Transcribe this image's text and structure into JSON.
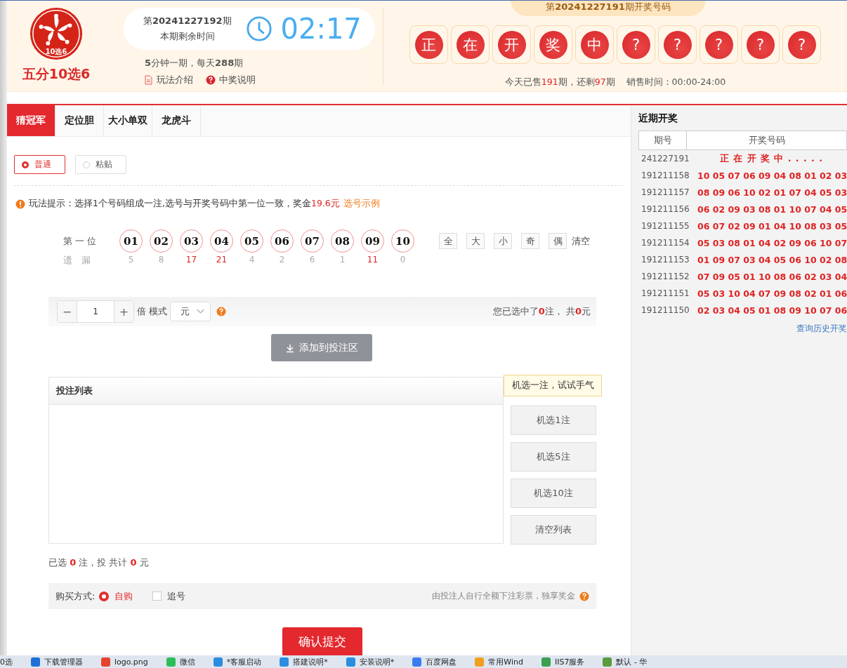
{
  "logo": {
    "badge": "10选6",
    "name": "五分10选6"
  },
  "current_issue": {
    "issue": "第**20241227192**期",
    "caption": "本期剩余时间",
    "countdown": "02:17",
    "frequency": "**5**分钟一期，每天**288**期"
  },
  "info_links": [
    {
      "kind": "doc",
      "label": "玩法介绍"
    },
    {
      "kind": "help",
      "label": "中奖说明"
    }
  ],
  "last_draw": {
    "title": "第**20241227191**期开奖号码",
    "balls": [
      "正",
      "在",
      "开",
      "奖",
      "中",
      "?",
      "?",
      "?",
      "?",
      "?"
    ],
    "sales": [
      {
        "text": "今天已售",
        "kind": "plain"
      },
      {
        "text": "191",
        "kind": "number"
      },
      {
        "text": "期，还剩",
        "kind": "plain"
      },
      {
        "text": "97",
        "kind": "number"
      },
      {
        "text": "期",
        "kind": "plain"
      }
    ],
    "sale_time": "销售时间：00:00-24:00"
  },
  "tabs": [
    {
      "label": "猜冠军",
      "selected": true
    },
    {
      "label": "定位胆",
      "selected": false
    },
    {
      "label": "大小单双",
      "selected": false
    },
    {
      "label": "龙虎斗",
      "selected": false
    }
  ],
  "input_modes": [
    {
      "label": "普通",
      "selected": true
    },
    {
      "label": "粘贴",
      "selected": false
    }
  ],
  "hint": {
    "segments": [
      {
        "text": "玩法提示：选择1个号码组成一注,选号与开奖号码中第一位一致，奖金",
        "kind": "plain"
      },
      {
        "text": "19.6元",
        "kind": "number"
      }
    ],
    "link": "选号示例"
  },
  "position": {
    "label": "第 一 位",
    "miss_label": "遗　漏",
    "numbers": [
      {
        "label": "01",
        "miss": "5",
        "hot": false
      },
      {
        "label": "02",
        "miss": "8",
        "hot": false
      },
      {
        "label": "03",
        "miss": "17",
        "hot": true
      },
      {
        "label": "04",
        "miss": "21",
        "hot": true
      },
      {
        "label": "05",
        "miss": "4",
        "hot": false
      },
      {
        "label": "06",
        "miss": "2",
        "hot": false
      },
      {
        "label": "07",
        "miss": "6",
        "hot": false
      },
      {
        "label": "08",
        "miss": "1",
        "hot": false
      },
      {
        "label": "09",
        "miss": "11",
        "hot": true
      },
      {
        "label": "10",
        "miss": "0",
        "hot": false
      }
    ],
    "quick": [
      {
        "label": "全",
        "kind": "box"
      },
      {
        "label": "大",
        "kind": "box"
      },
      {
        "label": "小",
        "kind": "box"
      },
      {
        "label": "奇",
        "kind": "box"
      },
      {
        "label": "偶",
        "kind": "box"
      },
      {
        "label": "清空",
        "kind": "text"
      }
    ]
  },
  "multiplier": {
    "minus": "−",
    "value": "1",
    "plus": "+",
    "unit": "倍",
    "mode_label": "模式",
    "mode": "元"
  },
  "selection_summary": [
    {
      "text": "您已选中了",
      "kind": "plain"
    },
    {
      "text": "0",
      "kind": "number"
    },
    {
      "text": "注， 共",
      "kind": "plain"
    },
    {
      "text": "0",
      "kind": "number"
    },
    {
      "text": "元",
      "kind": "plain"
    }
  ],
  "add_button": "添加到投注区",
  "bet_list": {
    "title": "投注列表"
  },
  "random_tip": "机选一注，试试手气",
  "side_buttons": [
    "机选1注",
    "机选5注",
    "机选10注",
    "清空列表"
  ],
  "totals": [
    {
      "text": "已选 ",
      "kind": "plain"
    },
    {
      "text": "0",
      "kind": "number"
    },
    {
      "text": " 注，投 共计 ",
      "kind": "plain"
    },
    {
      "text": "0",
      "kind": "number"
    },
    {
      "text": " 元",
      "kind": "plain"
    }
  ],
  "purchase": {
    "label": "购买方式:",
    "options": [
      {
        "label": "自购",
        "kind": "radio",
        "selected": true
      },
      {
        "label": "追号",
        "kind": "checkbox",
        "selected": false
      }
    ],
    "note": "由投注人自行全额下注彩票，独享奖金"
  },
  "submit": "确认提交",
  "recent": {
    "title": "近期开奖",
    "columns": [
      "期号",
      "开奖号码"
    ],
    "rows": [
      {
        "period": "241227191",
        "numbers": "正 在 开 奖 中 . . . . .",
        "kind": "pending"
      },
      {
        "period": "191211158",
        "numbers": "10 05 07 06 09 04 08 01 02 03",
        "kind": "result"
      },
      {
        "period": "191211157",
        "numbers": "08 09 06 10 02 01 07 04 05 03",
        "kind": "result"
      },
      {
        "period": "191211156",
        "numbers": "06 02 09 03 08 01 10 07 04 05",
        "kind": "result"
      },
      {
        "period": "191211155",
        "numbers": "06 07 02 09 01 04 10 08 03 05",
        "kind": "result"
      },
      {
        "period": "191211154",
        "numbers": "05 03 08 01 04 02 09 06 10 07",
        "kind": "result"
      },
      {
        "period": "191211153",
        "numbers": "01 09 07 03 04 05 06 10 02 08",
        "kind": "result"
      },
      {
        "period": "191211152",
        "numbers": "07 09 05 01 10 08 06 02 03 04",
        "kind": "result"
      },
      {
        "period": "191211151",
        "numbers": "05 03 10 04 07 09 08 02 01 06",
        "kind": "result"
      },
      {
        "period": "191211150",
        "numbers": "02 03 04 05 01 08 09 10 07 06",
        "kind": "result"
      }
    ],
    "history_link": "查询历史开奖"
  },
  "taskbar": [
    {
      "label": "0选",
      "kind": "plain"
    },
    {
      "label": "下载管理器",
      "kind": "download"
    },
    {
      "label": "logo.png",
      "kind": "browser"
    },
    {
      "label": "微信",
      "kind": "chat"
    },
    {
      "label": "*客服启动",
      "kind": "note"
    },
    {
      "label": "搭建说明*",
      "kind": "note"
    },
    {
      "label": "安装说明*",
      "kind": "note"
    },
    {
      "label": "百度网盘",
      "kind": "cloud"
    },
    {
      "label": "常用Wind",
      "kind": "folder"
    },
    {
      "label": "IIS7服务",
      "kind": "app"
    },
    {
      "label": "默认 - 华",
      "kind": "chart"
    }
  ]
}
